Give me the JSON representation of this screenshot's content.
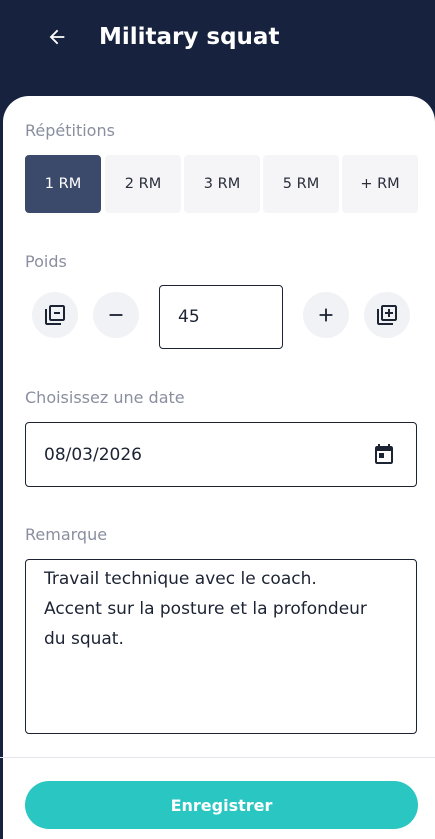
{
  "header": {
    "title": "Military squat",
    "back_icon": "arrow-left-icon"
  },
  "repetitions": {
    "label": "Répétitions",
    "options": [
      "1 RM",
      "2 RM",
      "3 RM",
      "5 RM",
      "+ RM"
    ],
    "selected": "1 RM"
  },
  "weight": {
    "label": "Poids",
    "value": "45",
    "icons": [
      "remove-multiple-icon",
      "minus-icon",
      "plus-icon",
      "add-multiple-icon"
    ]
  },
  "date": {
    "label": "Choisissez une date",
    "value": "08/03/2026",
    "icon": "calendar-icon"
  },
  "remark": {
    "label": "Remarque",
    "value": "Travail technique avec le coach.\nAccent sur la posture et la profondeur\ndu squat."
  },
  "save_label": "Enregistrer",
  "colors": {
    "header": "#17223f",
    "accent": "#2ac6c2",
    "selected": "#3b4a6b"
  }
}
